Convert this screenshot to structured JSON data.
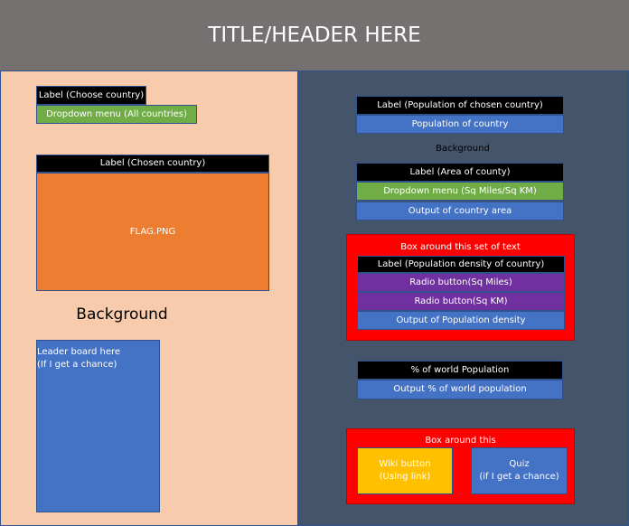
{
  "header": {
    "title": "TITLE/HEADER HERE"
  },
  "left": {
    "choose_label": "Label (Choose country)",
    "country_dropdown": "Dropdown menu (All countries)",
    "chosen_label": "Label (Chosen country)",
    "flag": "FLAG.PNG",
    "background": "Background",
    "leaderboard_line1": "Leader board here",
    "leaderboard_line2": "(If I get a chance)"
  },
  "right": {
    "population_label": "Label (Population of chosen country)",
    "population_output": "Population of country",
    "background": "Background",
    "area_label": "Label (Area of county)",
    "area_dropdown": "Dropdown menu (Sq Miles/Sq KM)",
    "area_output": "Output of country area",
    "density_box_title": "Box around this set of text",
    "density_label": "Label (Population density of country)",
    "radio_sq_miles": "Radio button(Sq Miles)",
    "radio_sq_km": "Radio button(Sq KM)",
    "density_output": "Output of Population density",
    "world_label": "% of world Population",
    "world_output": "Output % of world population",
    "bottom_box_title": "Box around this",
    "wiki_line1": "Wiki button",
    "wiki_line2": "(Using link)",
    "quiz_line1": "Quiz",
    "quiz_line2": "(if I get a chance)"
  },
  "colors": {
    "header": "#767171",
    "left_background": "#f8cbad",
    "right_background": "#44546a",
    "label": "#000000",
    "dropdown": "#70ad47",
    "output": "#4472c4",
    "radio": "#7030a0",
    "flag": "#ed7d31",
    "highlight_box": "#ff0000",
    "wiki": "#ffc000"
  }
}
